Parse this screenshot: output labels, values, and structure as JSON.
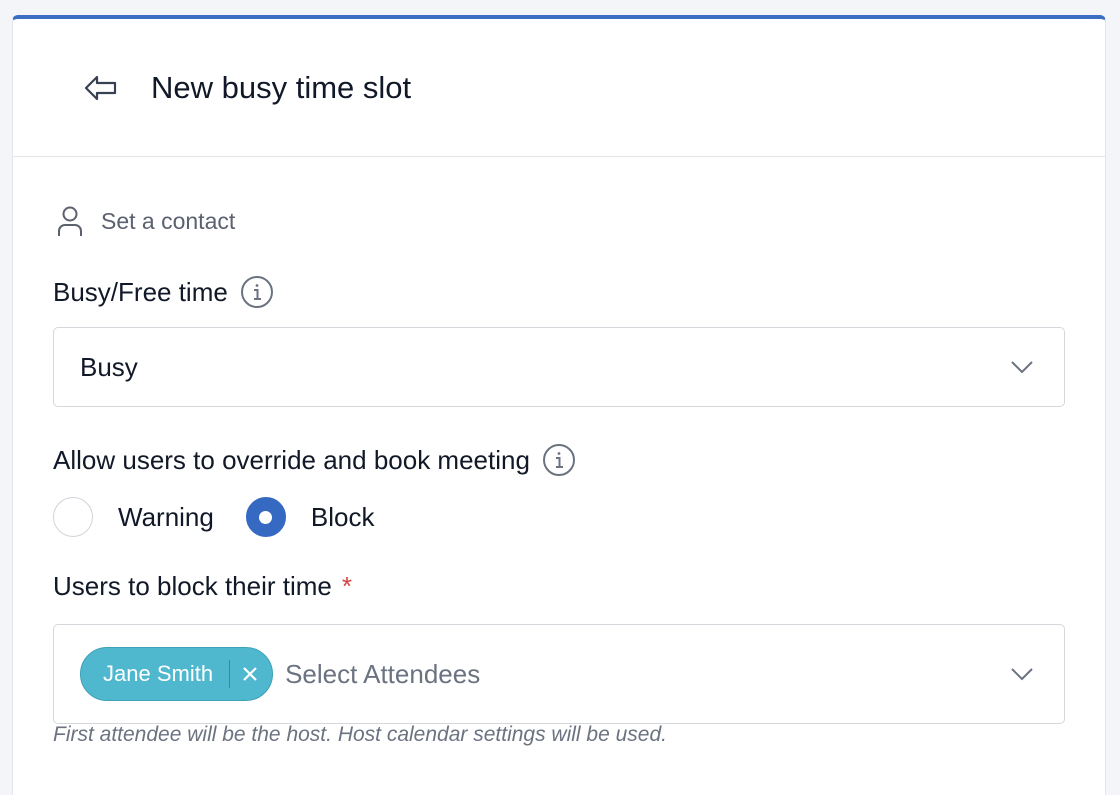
{
  "header": {
    "title": "New busy time slot"
  },
  "contact": {
    "label": "Set a contact"
  },
  "busy_free": {
    "label": "Busy/Free time",
    "value": "Busy"
  },
  "override": {
    "label": "Allow users to override and book meeting",
    "options": [
      {
        "label": "Warning",
        "checked": false
      },
      {
        "label": "Block",
        "checked": true
      }
    ]
  },
  "users": {
    "label": "Users to block their time",
    "required_mark": "*",
    "chips": [
      {
        "label": "Jane Smith"
      }
    ],
    "placeholder": "Select Attendees",
    "helper": "First attendee will be the host. Host calendar settings will be used."
  },
  "colors": {
    "accent": "#3569c2",
    "chip": "#4fb8cf",
    "required": "#d14343"
  }
}
